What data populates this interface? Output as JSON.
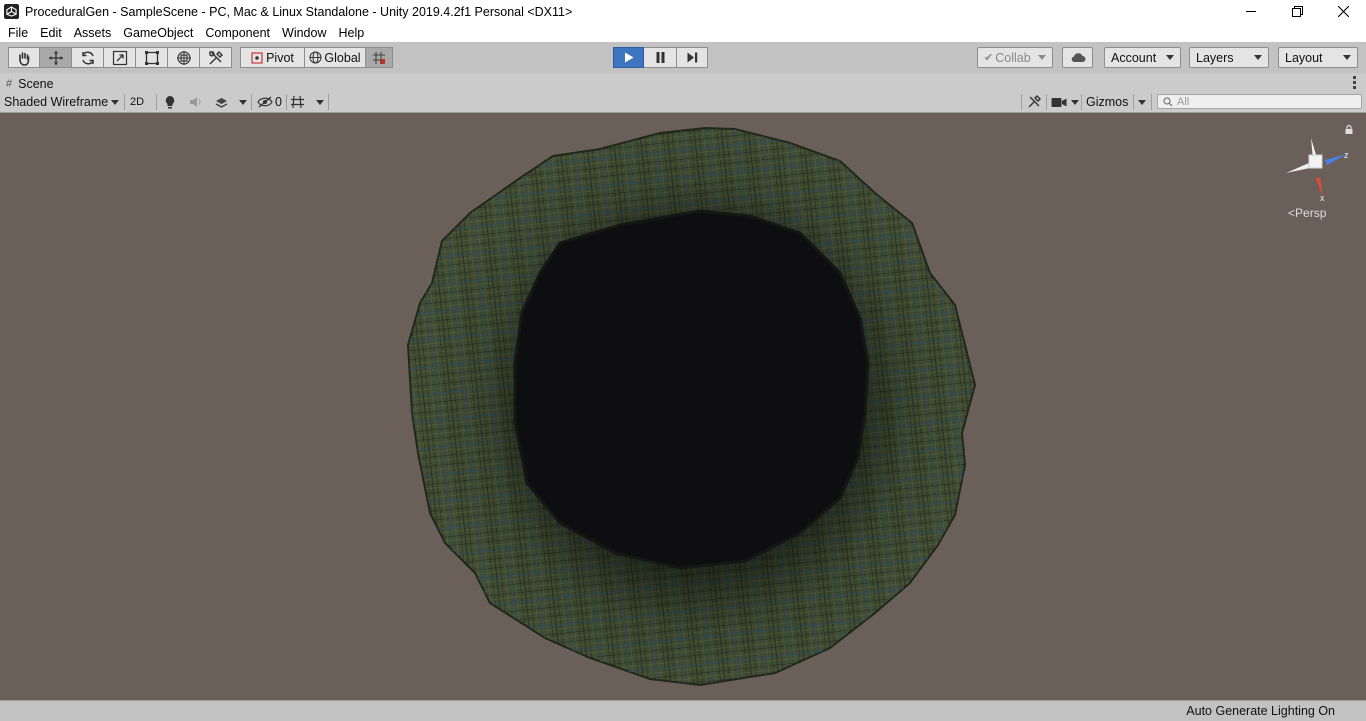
{
  "window": {
    "title": "ProceduralGen - SampleScene - PC, Mac & Linux Standalone - Unity 2019.4.2f1 Personal <DX11>"
  },
  "menu": [
    "File",
    "Edit",
    "Assets",
    "GameObject",
    "Component",
    "Window",
    "Help"
  ],
  "toolbar": {
    "pivot_label": "Pivot",
    "global_label": "Global",
    "collab_label": "Collab",
    "account_label": "Account",
    "layers_label": "Layers",
    "layout_label": "Layout",
    "play_state": "playing"
  },
  "scene": {
    "tab_label": "Scene",
    "draw_mode": "Shaded Wireframe",
    "mode_2d": "2D",
    "hidden_count": "0",
    "gizmos_label": "Gizmos",
    "search_placeholder": "All",
    "projection_label": "Persp",
    "axis_x": "x",
    "axis_z": "z"
  },
  "status": {
    "message": "Auto Generate Lighting On"
  },
  "colors": {
    "viewport_bg": "#6b6059",
    "chrome": "#c2c2c2",
    "play_active": "#3d75c0",
    "mesh_green": "#3b4a2a",
    "mesh_blue": "#2c4a6a",
    "hole": "#0e0e10"
  },
  "icons": [
    "unity-logo-icon",
    "hand-tool-icon",
    "move-tool-icon",
    "rotate-tool-icon",
    "scale-tool-icon",
    "rect-tool-icon",
    "transform-tool-icon",
    "custom-tool-icon",
    "grid-snap-icon",
    "play-icon",
    "pause-icon",
    "step-icon",
    "cloud-icon",
    "light-icon",
    "audio-icon",
    "effects-icon",
    "hidden-objects-icon",
    "grid-icon",
    "tools-icon",
    "camera-icon",
    "search-icon",
    "lock-icon",
    "scene-gizmo-icon"
  ]
}
